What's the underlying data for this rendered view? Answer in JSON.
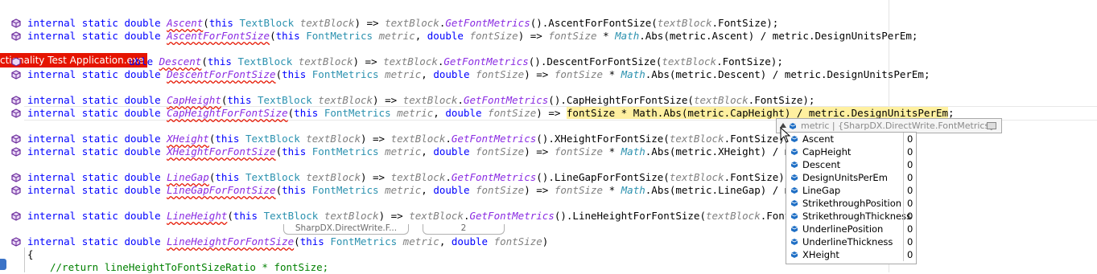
{
  "overlay_label": "ctionality Test Application.exe",
  "code": {
    "kw_internal": "internal",
    "kw_static": "static",
    "kw_double": "double",
    "kw_this": "this",
    "type_textblock": "TextBlock",
    "type_fontmetrics": "FontMetrics",
    "type_math": "Math",
    "param_textblock": "textBlock",
    "param_metric": "metric",
    "param_fontsize": "fontSize",
    "call_get_font_metrics": "GetFontMetrics",
    "methods": {
      "ascent": "Ascent",
      "ascent_ffs": "AscentForFontSize",
      "descent": "Descent",
      "descent_ffs": "DescentForFontSize",
      "capheight": "CapHeight",
      "capheight_ffs": "CapHeightForFontSize",
      "xheight": "XHeight",
      "xheight_ffs": "XHeightForFontSize",
      "linegap": "LineGap",
      "linegap_ffs": "LineGapForFontSize",
      "lineheight": "LineHeight",
      "lineheight_ffs": "LineHeightForFontSize"
    },
    "lines": {
      "l1_tail": ".AscentForFontSize(",
      "l2_tail": ".Abs(metric.Ascent) / metric.DesignUnitsPerEm;",
      "l3_tail": ".DescentForFontSize(",
      "l4_tail": ".Abs(metric.Descent) / metric.DesignUnitsPerEm;",
      "l5_tail": ".CapHeightForFontSize(",
      "l6_hl": "fontSize * Math.Abs(metric.CapHeight) / metric.DesignUnitsPerEm",
      "l7_tail": ".XHeightForFontSize(",
      "l8_tail": ".Abs(metric.XHeight) / metric.Des",
      "l9_tail": ".LineGapForFontSize(",
      "l10_tail": ".Abs(metric.LineGap) / metric.Des",
      "l11_tail": ".LineHeightForFontSize(",
      "fontsize_prop": ".FontSize);",
      "brace": "{",
      "comment": "//return lineHeightToFontSizeRatio * fontSize;"
    },
    "hints": [
      "SharpDX.DirectWrite.F...",
      "2"
    ]
  },
  "datatip": {
    "header_name": "metric",
    "header_type": "{SharpDX.DirectWrite.FontMetrics}",
    "members": [
      {
        "name": "Ascent",
        "value": "0"
      },
      {
        "name": "CapHeight",
        "value": "0"
      },
      {
        "name": "Descent",
        "value": "0"
      },
      {
        "name": "DesignUnitsPerEm",
        "value": "0"
      },
      {
        "name": "LineGap",
        "value": "0"
      },
      {
        "name": "StrikethroughPosition",
        "value": "0"
      },
      {
        "name": "StrikethroughThickness",
        "value": "0"
      },
      {
        "name": "UnderlinePosition",
        "value": "0"
      },
      {
        "name": "UnderlineThickness",
        "value": "0"
      },
      {
        "name": "XHeight",
        "value": "0"
      }
    ]
  },
  "colors": {
    "keyword": "#0000ff",
    "type": "#2b91af",
    "method": "#8a2be2",
    "param": "#808080",
    "comment": "#008000",
    "error_squiggle": "#e51400",
    "overlay_bg": "#e51400",
    "highlight": "#fff0a0"
  },
  "icons": {
    "method_glyph": "purple-cube-icon",
    "field_glyph": "blue-field-icon"
  }
}
